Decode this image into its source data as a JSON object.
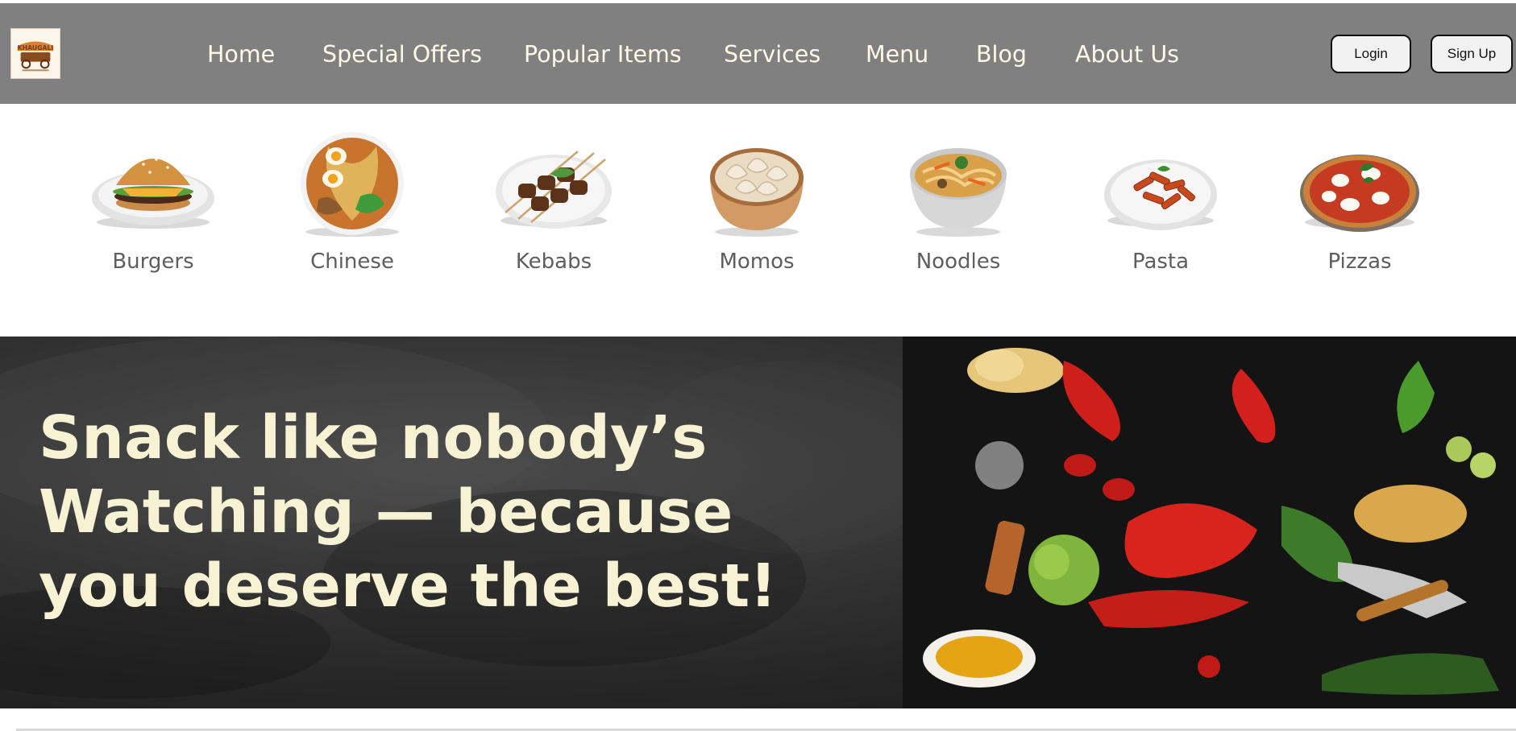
{
  "nav": {
    "links": [
      "Home",
      "Special Offers",
      "Popular Items",
      "Services",
      "Menu",
      "Blog",
      "About Us"
    ],
    "login_label": "Login",
    "signup_label": "Sign Up"
  },
  "logo": {
    "icon": "restaurant-logo"
  },
  "categories": [
    {
      "label": "Burgers",
      "icon": "burger-icon"
    },
    {
      "label": "Chinese",
      "icon": "chinese-bowl-icon"
    },
    {
      "label": "Kebabs",
      "icon": "kebab-icon"
    },
    {
      "label": "Momos",
      "icon": "momos-icon"
    },
    {
      "label": "Noodles",
      "icon": "noodles-icon"
    },
    {
      "label": "Pasta",
      "icon": "pasta-icon"
    },
    {
      "label": "Pizzas",
      "icon": "pizza-icon"
    }
  ],
  "hero": {
    "headline": "Snack like nobody’s Watching — because you deserve the best!",
    "image": "vegetables-chilies-image"
  },
  "colors": {
    "navbar": "#808080",
    "nav_text": "#fdfbe8",
    "hero_text": "#f6f2d3",
    "category_text": "#5e5e5e",
    "hero_bg": "#2a2a2a"
  }
}
